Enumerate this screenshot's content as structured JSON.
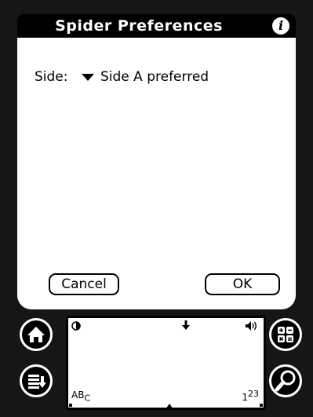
{
  "dialog": {
    "title": "Spider Preferences",
    "info_icon": "info-icon",
    "side_label": "Side:",
    "side_value": "Side A preferred",
    "cancel_label": "Cancel",
    "ok_label": "OK"
  },
  "silkscreen": {
    "abc_main": "AB",
    "abc_sub": "C",
    "num_main": "1",
    "num_sup": "23",
    "icons": [
      "home-icon",
      "menu-icon",
      "calculator-icon",
      "find-icon",
      "contrast-icon",
      "volume-icon"
    ]
  },
  "colors": {
    "screen_bg": "#ffffff",
    "title_bar": "#000000",
    "device_body": "#161616"
  }
}
